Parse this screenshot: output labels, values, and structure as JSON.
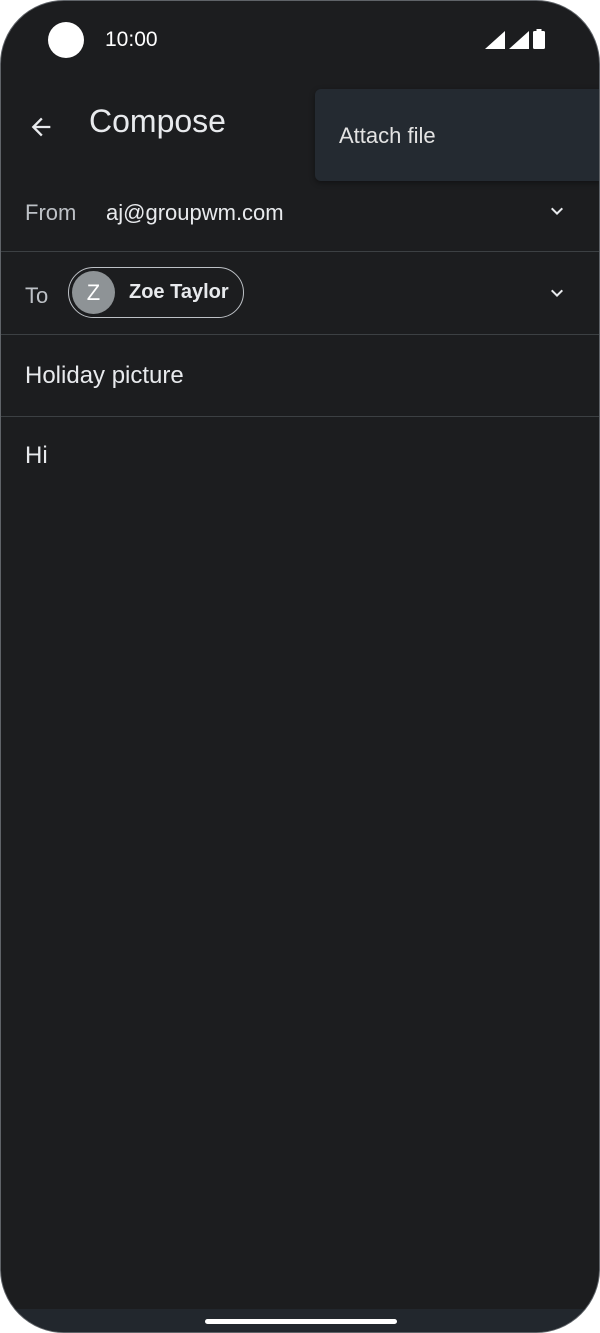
{
  "status_bar": {
    "time": "10:00",
    "icons": [
      "signal-icon",
      "wifi-icon",
      "battery-icon"
    ]
  },
  "app_bar": {
    "title": "Compose",
    "back_icon": "arrow-back-icon"
  },
  "overflow_menu": {
    "items": [
      {
        "label": "Attach file"
      }
    ]
  },
  "compose": {
    "from_label": "From",
    "from_value": "aj@groupwm.com",
    "to_label": "To",
    "recipient": {
      "initial": "Z",
      "name": "Zoe Taylor"
    },
    "subject": "Holiday picture",
    "body": "Hi"
  },
  "colors": {
    "background": "#1c1d1f",
    "menu_background": "#242a31",
    "text_primary": "#e8eaed",
    "text_secondary": "#bdc1c6",
    "avatar": "#8e9396"
  }
}
